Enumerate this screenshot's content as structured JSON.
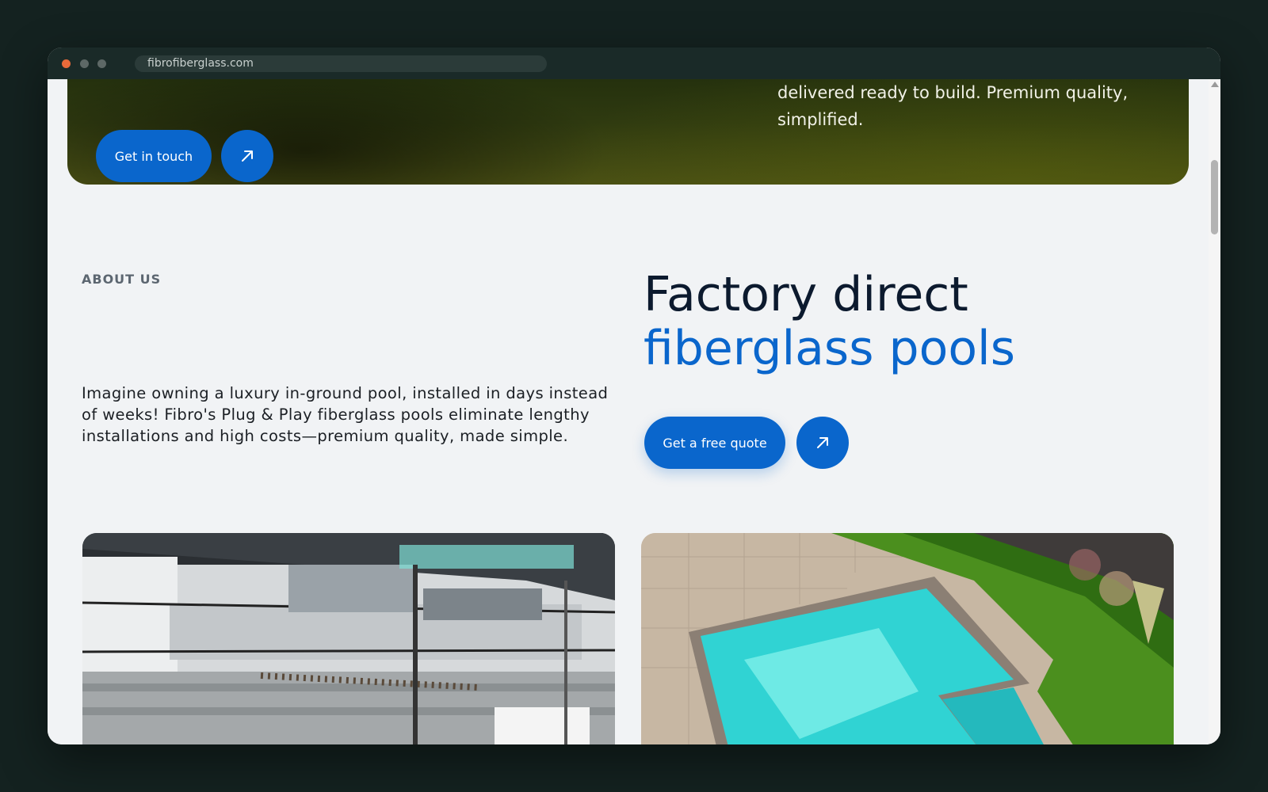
{
  "browser": {
    "url": "fibrofiberglass.com"
  },
  "hero": {
    "cta_label": "Get in touch",
    "cta_icon": "arrow-up-right-icon",
    "text": "delivered ready to build. Premium quality, simplified."
  },
  "about": {
    "label": "ABOUT US",
    "body": "Imagine owning a luxury in-ground pool, installed in days instead of weeks! Fibro's Plug & Play fiberglass pools eliminate lengthy installations and high costs—premium quality, made simple.",
    "headline_line1": "Factory direct",
    "headline_line2": "fiberglass pools",
    "cta_label": "Get a free quote",
    "cta_icon": "arrow-up-right-icon"
  },
  "colors": {
    "accent": "#0a66cc",
    "headline_dark": "#0c1a2e",
    "page_bg": "#f1f3f5"
  }
}
